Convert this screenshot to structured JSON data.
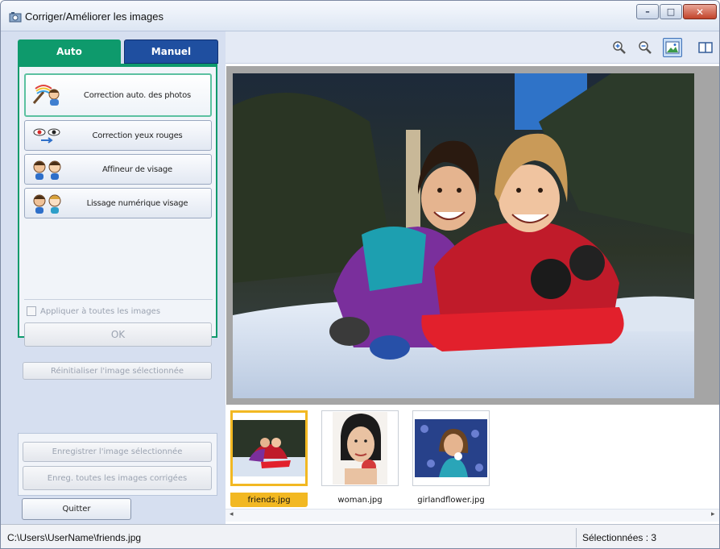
{
  "window": {
    "title": "Corriger/Améliorer les images",
    "minimize_glyph": "–",
    "maximize_glyph": "□",
    "close_glyph": "✕"
  },
  "tabs": [
    {
      "label": "Auto",
      "active": true
    },
    {
      "label": "Manuel",
      "active": false
    }
  ],
  "tools": [
    {
      "label": "Correction auto. des photos",
      "icon": "auto-photo-correction-icon",
      "selected": true
    },
    {
      "label": "Correction yeux rouges",
      "icon": "red-eye-correction-icon",
      "selected": false
    },
    {
      "label": "Affineur de visage",
      "icon": "face-sharpener-icon",
      "selected": false
    },
    {
      "label": "Lissage numérique visage",
      "icon": "digital-face-smoothing-icon",
      "selected": false
    }
  ],
  "apply_all": {
    "label": "Appliquer à toutes les images",
    "checked": false,
    "enabled": false
  },
  "buttons": {
    "ok": "OK",
    "reset": "Réinitialiser l'image sélectionnée",
    "save_selected": "Enregistrer l'image sélectionnée",
    "save_all": "Enreg. toutes les images corrigées",
    "quit": "Quitter"
  },
  "toolbar": {
    "icons": [
      "zoom-in-icon",
      "zoom-out-icon",
      "whole-image-view-icon",
      "compare-view-icon"
    ],
    "active": "whole-image-view-icon"
  },
  "thumbnails": [
    {
      "label": "friends.jpg",
      "selected": true
    },
    {
      "label": "woman.jpg",
      "selected": false
    },
    {
      "label": "girlandflower.jpg",
      "selected": false
    }
  ],
  "status": {
    "path": "C:\\Users\\UserName\\friends.jpg",
    "selected_count": "Sélectionnées : 3"
  },
  "colors": {
    "auto_tab": "#0e9a6c",
    "manuel_tab": "#1f4fa0",
    "thumb_selection": "#f2b822",
    "close_button": "#c2432a"
  }
}
